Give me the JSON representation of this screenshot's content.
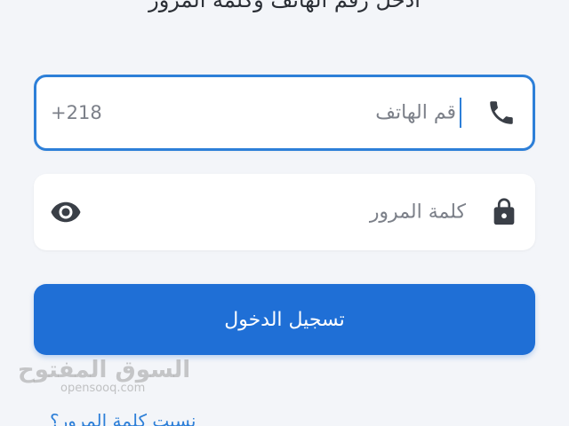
{
  "heading": "ادخل رقم الهاتف وكلمة المرور",
  "phone_field": {
    "placeholder": "قم الهاتف",
    "prefix": "+218",
    "icon": "phone-icon"
  },
  "password_field": {
    "placeholder": "كلمة المرور",
    "icon": "lock-icon",
    "toggle_icon": "eye-icon"
  },
  "login_button": {
    "label": "تسجيل الدخول"
  },
  "watermark": {
    "arabic": "السوق المفتوح",
    "latin": "opensooq.com"
  },
  "forgot_password": "نسيت كلمة المرور؟",
  "colors": {
    "accent": "#2d7fd8",
    "button": "#1f6fd6",
    "background": "#f3f5f9"
  }
}
